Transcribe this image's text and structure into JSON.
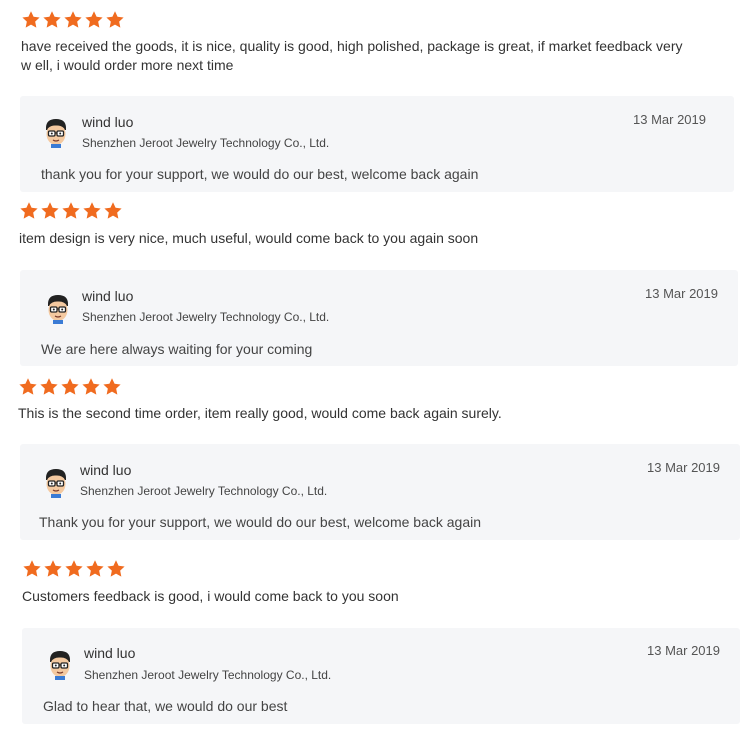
{
  "colors": {
    "star": "#f06b1f",
    "reply_bg": "#f5f6f8",
    "text": "#333333"
  },
  "reviews": [
    {
      "rating": 5,
      "text": "have received the goods, it is nice, quality is good, high polished, package is great, if market feedback very w ell, i would order more next time",
      "reply": {
        "author": "wind luo",
        "company": "Shenzhen Jeroot Jewelry Technology Co., Ltd.",
        "date": "13 Mar 2019",
        "text": "thank you for your support, we would do our best, welcome back again",
        "avatar_icon": "avatar-glasses-icon"
      }
    },
    {
      "rating": 5,
      "text": "item design is very nice, much useful, would come back to you again soon",
      "reply": {
        "author": "wind luo",
        "company": "Shenzhen Jeroot Jewelry Technology Co., Ltd.",
        "date": "13 Mar 2019",
        "text": "We are here always waiting for your coming",
        "avatar_icon": "avatar-glasses-icon"
      }
    },
    {
      "rating": 5,
      "text": "This is the second time order, item really good, would come back again surely.",
      "reply": {
        "author": "wind luo",
        "company": "Shenzhen Jeroot Jewelry Technology Co., Ltd.",
        "date": "13 Mar 2019",
        "text": "Thank you for your support, we would do our best, welcome back again",
        "avatar_icon": "avatar-glasses-icon"
      }
    },
    {
      "rating": 5,
      "text": "Customers feedback is good, i would come back to you soon",
      "reply": {
        "author": "wind luo",
        "company": "Shenzhen Jeroot Jewelry Technology Co., Ltd.",
        "date": "13 Mar 2019",
        "text": "Glad to hear that, we would do our best",
        "avatar_icon": "avatar-glasses-icon"
      }
    }
  ]
}
